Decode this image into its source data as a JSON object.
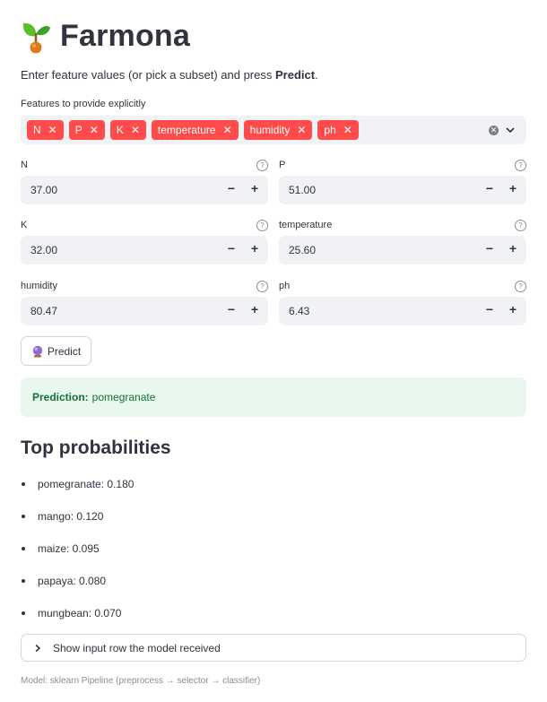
{
  "header": {
    "title": "Farmona",
    "logo_icon": "seedling-icon"
  },
  "intro": {
    "text_before": "Enter feature values (or pick a subset) and press ",
    "text_bold": "Predict",
    "text_after": "."
  },
  "feature_select": {
    "label": "Features to provide explicitly",
    "tags": [
      "N",
      "P",
      "K",
      "temperature",
      "humidity",
      "ph"
    ]
  },
  "fields": {
    "n": {
      "label": "N",
      "value": "37.00"
    },
    "p": {
      "label": "P",
      "value": "51.00"
    },
    "k": {
      "label": "K",
      "value": "32.00"
    },
    "temperature": {
      "label": "temperature",
      "value": "25.60"
    },
    "humidity": {
      "label": "humidity",
      "value": "80.47"
    },
    "ph": {
      "label": "ph",
      "value": "6.43"
    }
  },
  "stepper": {
    "minus": "−",
    "plus": "+",
    "help": "?"
  },
  "predict_button": {
    "label": "Predict",
    "icon": "crystal-ball-icon"
  },
  "result": {
    "label": "Prediction:",
    "value": "pomegranate"
  },
  "probabilities": {
    "heading": "Top probabilities",
    "items": [
      "pomegranate: 0.180",
      "mango: 0.120",
      "maize: 0.095",
      "papaya: 0.080",
      "mungbean: 0.070"
    ]
  },
  "expander": {
    "label": "Show input row the model received"
  },
  "footnote": "Model: sklearn Pipeline (preprocess → selector → classifier)",
  "colors": {
    "accent": "#ff4b4b",
    "success_bg": "#e8f8ee",
    "success_text": "#177233",
    "input_bg": "#f0f2f6"
  }
}
